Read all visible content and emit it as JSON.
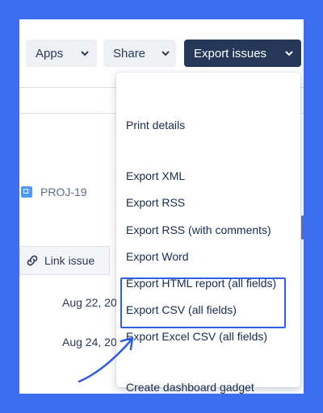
{
  "toolbar": {
    "apps_label": "Apps",
    "share_label": "Share",
    "export_label": "Export issues"
  },
  "issue": {
    "project_key": "PROJ-19",
    "link_issue_label": "Link issue",
    "dates": [
      "Aug 22, 20",
      "Aug 24, 20"
    ]
  },
  "export_menu": {
    "items": [
      "Print details",
      "Export XML",
      "Export RSS",
      "Export RSS (with comments)",
      "Export Word",
      "Export HTML report (all fields)",
      "Export CSV (all fields)",
      "Export Excel CSV (all fields)",
      "Create dashboard gadget"
    ]
  },
  "colors": {
    "background": "#3d6ef0",
    "primary_button": "#253858",
    "highlight": "#2f5fe0"
  }
}
